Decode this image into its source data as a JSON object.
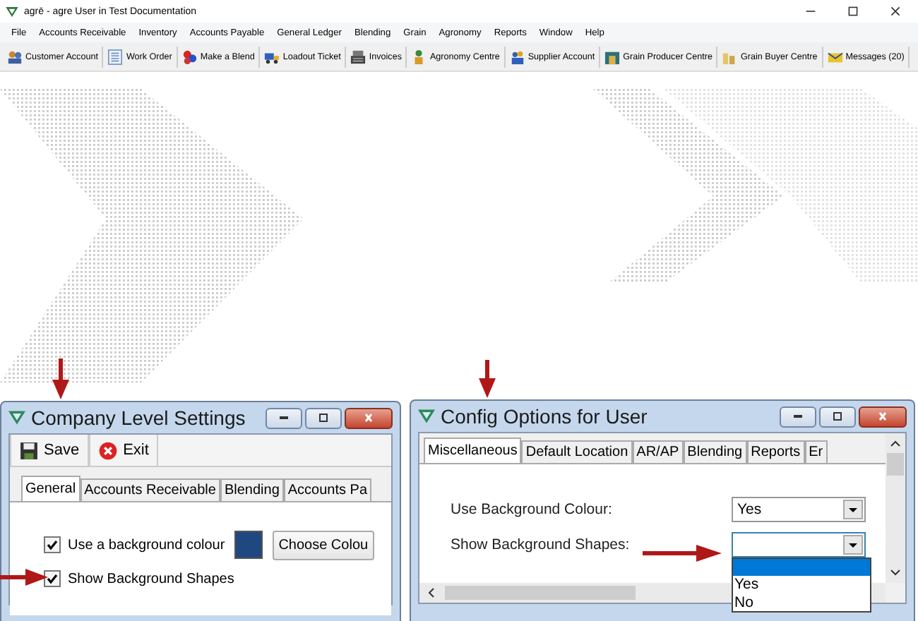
{
  "window": {
    "title": "agrē - agre User in Test Documentation"
  },
  "menu": [
    "File",
    "Accounts Receivable",
    "Inventory",
    "Accounts Payable",
    "General Ledger",
    "Blending",
    "Grain",
    "Agronomy",
    "Reports",
    "Window",
    "Help"
  ],
  "toolbar": [
    "Customer Account",
    "Work Order",
    "Make a Blend",
    "Loadout Ticket",
    "Invoices",
    "Agronomy Centre",
    "Supplier Account",
    "Grain Producer Centre",
    "Grain Buyer Centre",
    "Messages (20)"
  ],
  "company_settings": {
    "title": "Company Level Settings",
    "actions": [
      "Save",
      "Exit"
    ],
    "tabs": [
      {
        "label": "General",
        "selected": true
      },
      {
        "label": "Accounts Receivable",
        "selected": false
      },
      {
        "label": "Blending",
        "selected": false
      },
      {
        "label": "Accounts Pa",
        "selected": false
      }
    ],
    "options": [
      {
        "label": "Use a background colour",
        "checked": true
      },
      {
        "label": "Show Background Shapes",
        "checked": true
      }
    ],
    "colour_button": "Choose Colou"
  },
  "config_options": {
    "title": "Config Options for User",
    "tabs": [
      {
        "label": "Miscellaneous",
        "selected": true
      },
      {
        "label": "Default Location",
        "selected": false
      },
      {
        "label": "AR/AP",
        "selected": false
      },
      {
        "label": "Blending",
        "selected": false
      },
      {
        "label": "Reports",
        "selected": false
      },
      {
        "label": "Er",
        "selected": false
      }
    ],
    "fields": [
      {
        "label": "Use Background Colour:",
        "value": "Yes",
        "open": false
      },
      {
        "label": "Show Background Shapes:",
        "open": true,
        "options": [
          {
            "selected": true
          },
          {
            "label": "Yes",
            "selected": false
          },
          {
            "label": "No",
            "selected": false
          }
        ]
      }
    ]
  }
}
